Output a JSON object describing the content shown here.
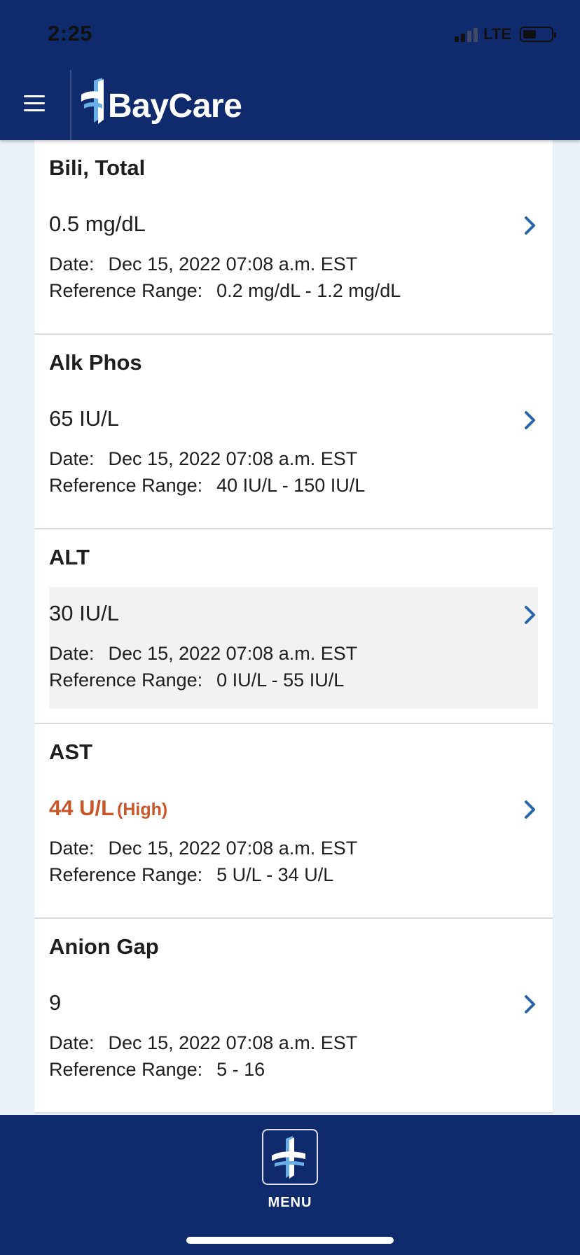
{
  "status_bar": {
    "time": "2:25",
    "network": "LTE"
  },
  "header": {
    "brand": "BayCare"
  },
  "results": [
    {
      "name": "Bili, Total",
      "value": "0.5 mg/dL",
      "flag": "",
      "date_label": "Date:",
      "date": "Dec 15, 2022 07:08 a.m. EST",
      "range_label": "Reference Range:",
      "range": "0.2 mg/dL - 1.2 mg/dL"
    },
    {
      "name": "Alk Phos",
      "value": "65 IU/L",
      "flag": "",
      "date_label": "Date:",
      "date": "Dec 15, 2022 07:08 a.m. EST",
      "range_label": "Reference Range:",
      "range": "40 IU/L - 150 IU/L"
    },
    {
      "name": "ALT",
      "value": "30 IU/L",
      "flag": "",
      "date_label": "Date:",
      "date": "Dec 15, 2022 07:08 a.m. EST",
      "range_label": "Reference Range:",
      "range": "0 IU/L - 55 IU/L"
    },
    {
      "name": "AST",
      "value": "44 U/L",
      "flag": "(High)",
      "date_label": "Date:",
      "date": "Dec 15, 2022 07:08 a.m. EST",
      "range_label": "Reference Range:",
      "range": "5 U/L - 34 U/L"
    },
    {
      "name": "Anion Gap",
      "value": "9",
      "flag": "",
      "date_label": "Date:",
      "date": "Dec 15, 2022 07:08 a.m. EST",
      "range_label": "Reference Range:",
      "range": "5 - 16"
    }
  ],
  "bottom_nav": {
    "menu_label": "MENU"
  },
  "colors": {
    "navy": "#0f2a6d",
    "high": "#c8562a",
    "link": "#2a66a8",
    "logo_light": "#6ab0e6"
  },
  "icons": {
    "menu": "hamburger-icon",
    "chevron": "chevron-right-icon",
    "logo": "baycare-cross-icon"
  }
}
